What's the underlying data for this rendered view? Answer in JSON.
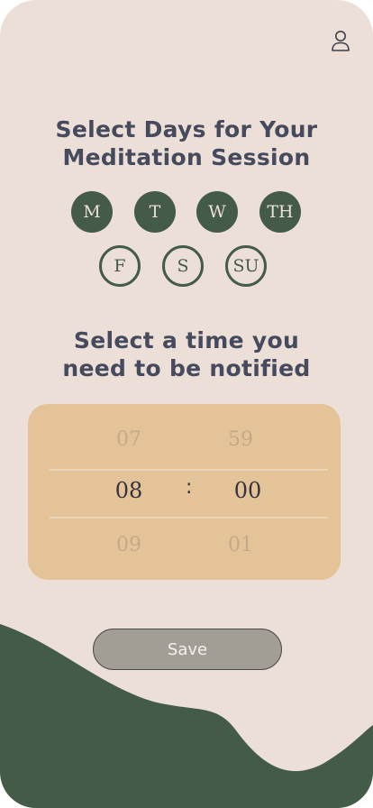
{
  "colors": {
    "background": "#ecdfd7",
    "accent_green": "#445c47",
    "picker_bg": "#e5c399",
    "title_text": "#454a5c",
    "save_bg": "#a39e95"
  },
  "header": {
    "profile_icon": "user-icon"
  },
  "days_section": {
    "title_line1": "Select Days for Your",
    "title_line2": "Meditation Session",
    "days": [
      {
        "label": "M",
        "selected": true
      },
      {
        "label": "T",
        "selected": true
      },
      {
        "label": "W",
        "selected": true
      },
      {
        "label": "TH",
        "selected": true
      },
      {
        "label": "F",
        "selected": false
      },
      {
        "label": "S",
        "selected": false
      },
      {
        "label": "SU",
        "selected": false
      }
    ]
  },
  "time_section": {
    "title_line1": "Select a time you",
    "title_line2": "need to be notified",
    "picker": {
      "hours_prev": "07",
      "hours": "08",
      "hours_next": "09",
      "separator": ":",
      "minutes_prev": "59",
      "minutes": "00",
      "minutes_next": "01"
    }
  },
  "save_label": "Save"
}
